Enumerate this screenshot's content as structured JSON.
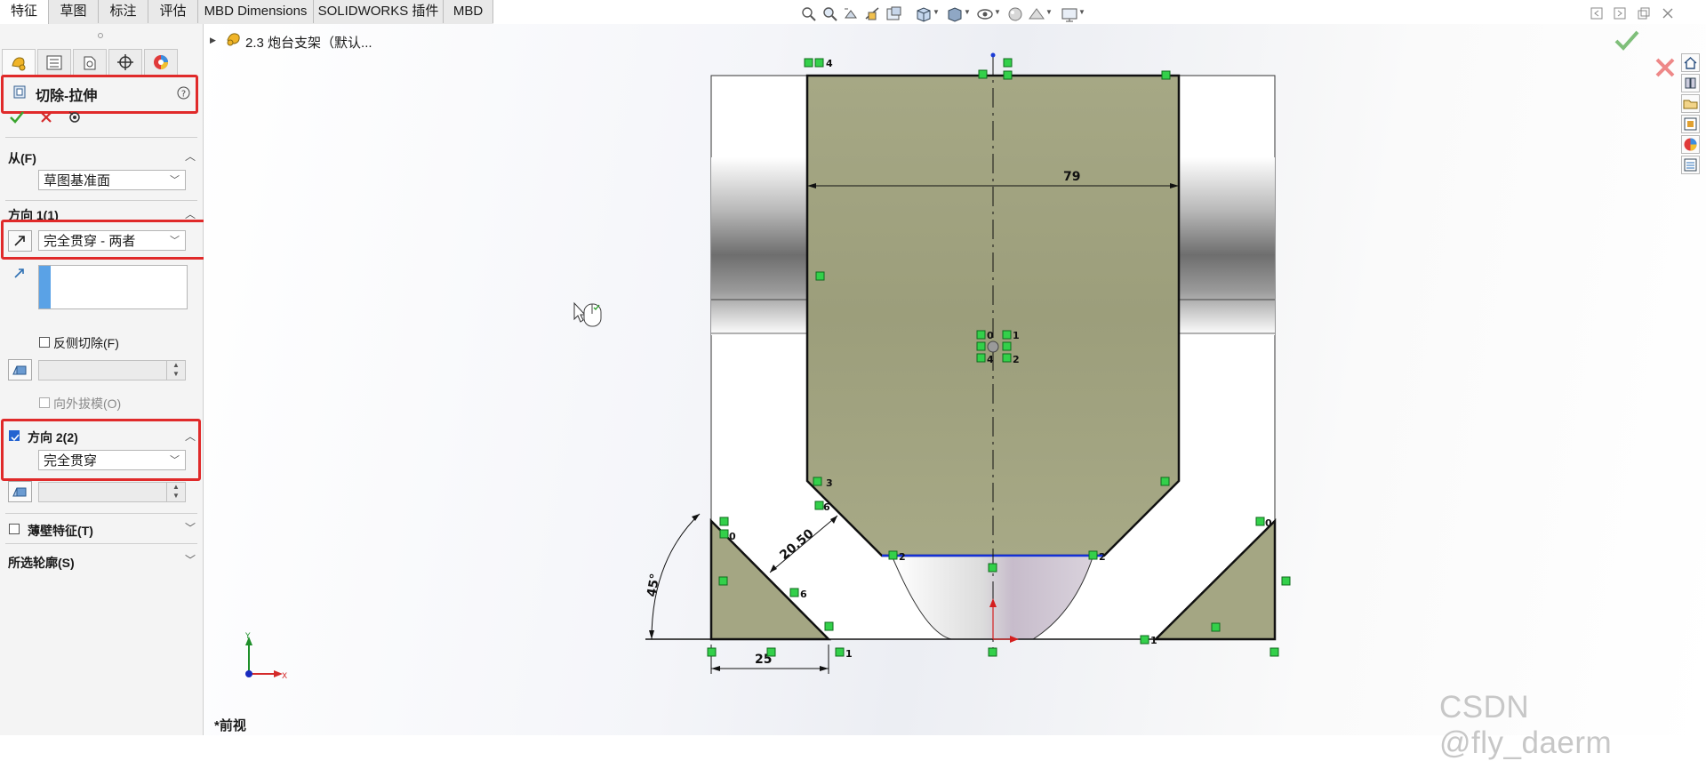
{
  "tabs": [
    "特征",
    "草图",
    "标注",
    "评估",
    "MBD Dimensions",
    "SOLIDWORKS 插件",
    "MBD"
  ],
  "active_tab": "特征",
  "feature_tree": {
    "label": "2.3 炮台支架（默认..."
  },
  "panel": {
    "title": "切除-拉伸",
    "help_icon": "help-icon",
    "from": {
      "label": "从(F)",
      "value": "草图基准面"
    },
    "dir1": {
      "label": "方向 1(1)",
      "value": "完全贯穿 - 两者"
    },
    "flip_side": {
      "label": "反侧切除(F)",
      "checked": false
    },
    "draft": {
      "label": "向外拔模(O)",
      "checked": false
    },
    "dir2": {
      "label": "方向 2(2)",
      "checked": true,
      "value": "完全贯穿"
    },
    "thin": {
      "label": "薄壁特征(T)",
      "checked": false
    },
    "contours": {
      "label": "所选轮廓(S)"
    }
  },
  "sketch": {
    "dim_79": "79",
    "dim_20_50": "20.50",
    "dim_25": "25",
    "dim_45": "45°",
    "relation_numbers": [
      "4",
      "3",
      "2",
      "1",
      "0",
      "6"
    ]
  },
  "view_label": "*前视",
  "triad": {
    "x": "X",
    "y": "Y"
  },
  "watermark": "CSDN @fly_daerm",
  "colors": {
    "highlight": "#e02a2a",
    "sketch_fill": "#a4a683",
    "relation_marker": "#2ecc40",
    "confirm_green": "#52b046",
    "cancel_red": "#e06060"
  }
}
